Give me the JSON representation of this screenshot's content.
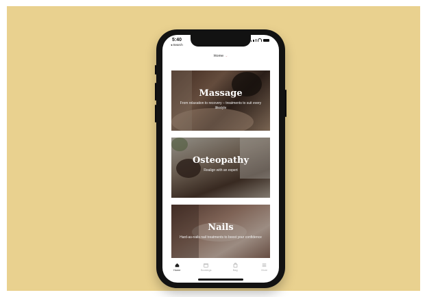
{
  "status_bar": {
    "time": "5:40",
    "back_label": "◂ Search"
  },
  "nav": {
    "title": "Home",
    "chevron": "⌄"
  },
  "cards": [
    {
      "title": "Massage",
      "subtitle": "From relaxation to recovery – treatments to suit every lifestyle"
    },
    {
      "title": "Osteopathy",
      "subtitle": "Realign with an expert"
    },
    {
      "title": "Nails",
      "subtitle": "Hard-as-nails nail treatments to boost your confidence"
    }
  ],
  "tabbar": {
    "items": [
      {
        "label": "Home",
        "icon": "home-icon",
        "active": true
      },
      {
        "label": "Bookings",
        "icon": "calendar-icon",
        "active": false
      },
      {
        "label": "Bag",
        "icon": "bag-icon",
        "active": false
      },
      {
        "label": "More",
        "icon": "menu-icon",
        "active": false
      }
    ]
  },
  "colors": {
    "background": "#e9d18f",
    "phone": "#121212",
    "accent": "#d6a0a5"
  }
}
